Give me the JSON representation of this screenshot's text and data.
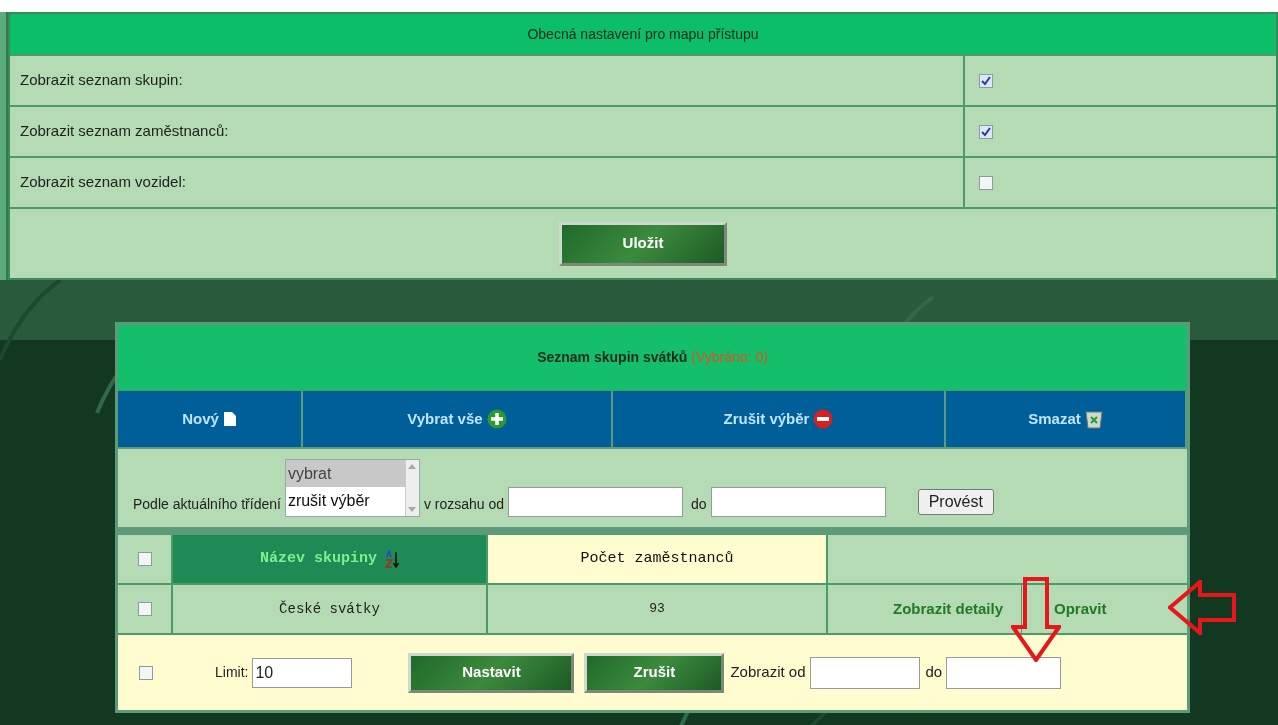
{
  "settings": {
    "title": "Obecná nastavení pro mapu přístupu",
    "rows": [
      {
        "label": "Zobrazit seznam skupin:",
        "checked": true
      },
      {
        "label": "Zobrazit seznam zaměstnanců:",
        "checked": true
      },
      {
        "label": "Zobrazit seznam vozidel:",
        "checked": false
      }
    ],
    "save_button": "Uložit"
  },
  "holiday_groups": {
    "title": "Seznam skupin svátků",
    "selected_count": "(Vybráno: 0)",
    "toolbar": [
      {
        "label": "Nový",
        "kind": "new"
      },
      {
        "label": "Vybrat vše",
        "kind": "add"
      },
      {
        "label": "Zrušit výběr",
        "kind": "remove"
      },
      {
        "label": "Smazat",
        "kind": "delete"
      }
    ],
    "filter": {
      "label": "Podle aktuálního třídení",
      "options": [
        {
          "label": "vybrat",
          "selected": true
        },
        {
          "label": "zrušit výběr",
          "selected": false
        }
      ],
      "range_label": "v rozsahu od",
      "to_label": "do",
      "button": "Provést"
    },
    "table": {
      "select_all_checked": false,
      "columns": [
        {
          "label": "Název skupiny",
          "sorted": true
        },
        {
          "label": "Počet zaměstnanců",
          "sorted": false
        }
      ],
      "rows": [
        {
          "checked": false,
          "name": "České svátky",
          "count": "93",
          "actions": [
            "Zobrazit detaily",
            "Opravit"
          ]
        }
      ]
    },
    "footer": {
      "checked": false,
      "limit_label": "Limit:",
      "limit_value": "10",
      "set_button": "Nastavit",
      "cancel_button": "Zrušit",
      "from_label": "Zobrazit od",
      "to_label": "do"
    }
  }
}
